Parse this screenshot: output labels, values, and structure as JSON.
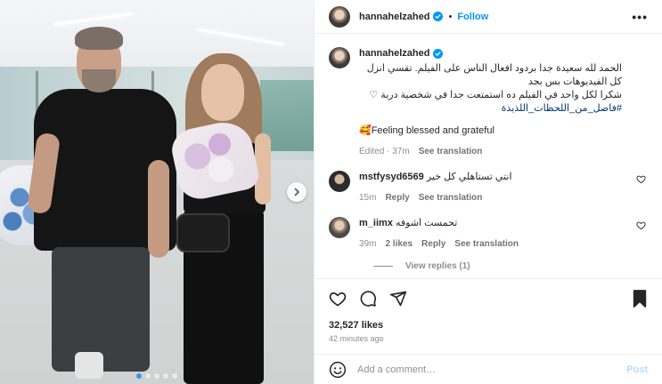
{
  "post": {
    "username": "hannahelzahed",
    "follow_label": "Follow",
    "separator": "•",
    "more_label": "•••"
  },
  "caption": {
    "username": "hannahelzahed",
    "line1": "الحمد لله سعيدة جدا بردود افعال الناس على الفيلم. تقسي انزل كل الفيديوهات بس بجد",
    "line2": "شكرا لكل واحد في الفيلم ده استمتعت جدا في شخصية دربة ♡",
    "hashtag": "#فاصل_من_اللحظات_اللذيذة",
    "feeling": "🥰Feeling blessed and grateful",
    "edited": "Edited · 37m",
    "see_translation": "See translation"
  },
  "comments": [
    {
      "username": "mstfysyd6569",
      "text": "انتي تستاهلي كل خير",
      "time": "15m",
      "likes": "",
      "reply": "Reply",
      "see_translation": "See translation",
      "avatar_color": "#2b2b2b"
    },
    {
      "username": "m_iimx",
      "text": "تحمست اشوفه",
      "time": "39m",
      "likes": "2 likes",
      "reply": "Reply",
      "see_translation": "See translation",
      "avatar_color": "#9e8c79"
    }
  ],
  "view_replies": "View replies (1)",
  "stats": {
    "likes": "32,527 likes",
    "posted_ago": "42 minutes ago"
  },
  "composer": {
    "placeholder": "Add a comment…",
    "post_label": "Post"
  },
  "carousel": {
    "slide_count": 5,
    "active_index": 0
  },
  "colors": {
    "link_blue": "#0095f6",
    "verified_blue": "#0095f6",
    "muted": "#8e8e8e",
    "post_disabled": "#b3dbff"
  }
}
